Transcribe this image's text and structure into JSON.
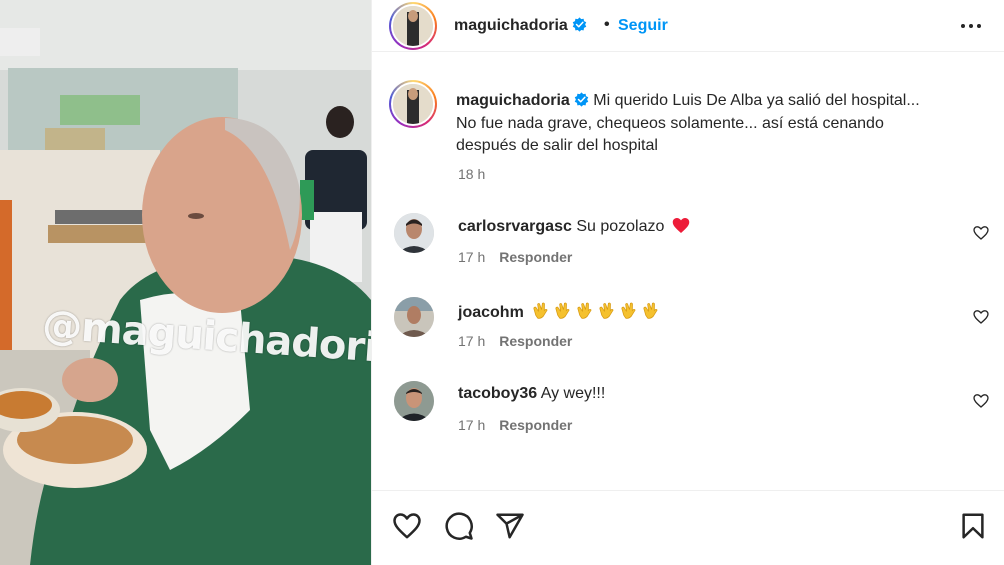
{
  "post": {
    "username": "maguichadoria",
    "dot": "•",
    "follow_label": "Seguir",
    "caption_line1": "Mi querido Luis De Alba ya salió del hospital...",
    "caption_line2": "No fue nada grave, chequeos solamente... así está cenando",
    "caption_line3": "después de salir del hospital",
    "time": "18 h",
    "watermark": "@maguichadoria"
  },
  "comments": [
    {
      "user": "carlosrvargasc",
      "text": "Su pozolazo",
      "emoji": "red-heart",
      "time": "17 h",
      "reply_label": "Responder"
    },
    {
      "user": "joacohm",
      "text": "",
      "emoji": "clapping-hands-x6",
      "time": "17 h",
      "reply_label": "Responder"
    },
    {
      "user": "tacoboy36",
      "text": "Ay wey!!!",
      "emoji": "",
      "time": "17 h",
      "reply_label": "Responder"
    }
  ],
  "colors": {
    "link_blue": "#0095f6",
    "verified_blue": "#0095f6",
    "text": "#262626",
    "secondary_text": "#737373",
    "border": "#efefef",
    "heart_red": "#ed1c39",
    "clap_yellow": "#f5c12e"
  },
  "icons": [
    "verified-badge-icon",
    "more-options-icon",
    "like-heart-icon",
    "comment-icon",
    "share-icon",
    "save-bookmark-icon"
  ]
}
